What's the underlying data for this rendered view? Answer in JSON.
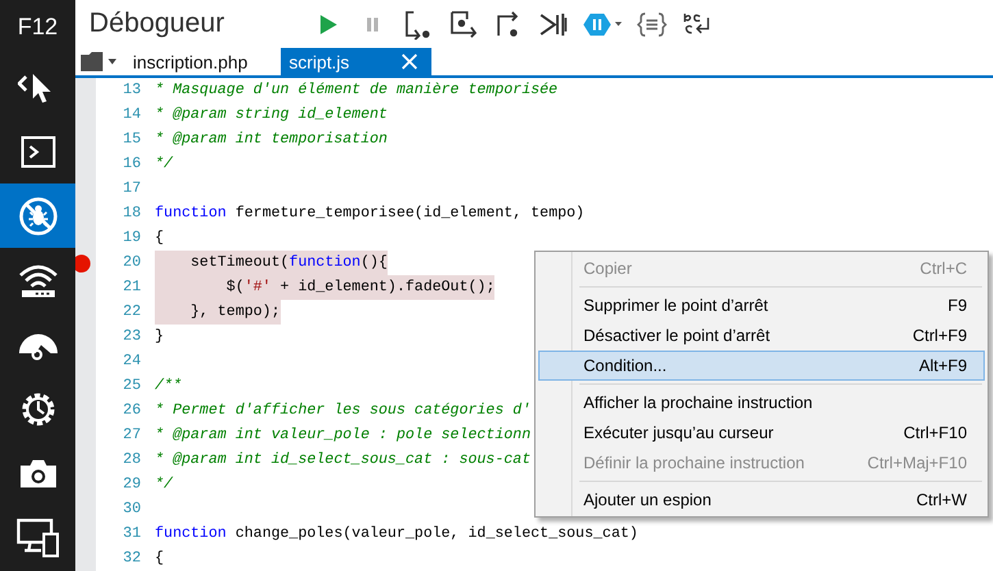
{
  "sidebar": {
    "title": "F12",
    "items": [
      {
        "kind": "pointer",
        "selected": false
      },
      {
        "kind": "console",
        "selected": false
      },
      {
        "kind": "debugger",
        "selected": true
      },
      {
        "kind": "network",
        "selected": false
      },
      {
        "kind": "gauge",
        "selected": false
      },
      {
        "kind": "clock",
        "selected": false
      },
      {
        "kind": "camera",
        "selected": false
      },
      {
        "kind": "devices",
        "selected": false
      }
    ]
  },
  "toolbar": {
    "title": "Débogueur",
    "buttons": [
      {
        "kind": "continue",
        "disabled": false
      },
      {
        "kind": "pause",
        "disabled": true
      },
      {
        "kind": "step-into",
        "disabled": false
      },
      {
        "kind": "step-over",
        "disabled": false
      },
      {
        "kind": "step-out",
        "disabled": false
      },
      {
        "kind": "break-new-worker",
        "disabled": false
      },
      {
        "kind": "exceptions",
        "disabled": false
      },
      {
        "kind": "pretty-print",
        "disabled": false
      },
      {
        "kind": "word-wrap",
        "disabled": false
      }
    ]
  },
  "tabs": [
    {
      "label": "inscription.php",
      "selected": false
    },
    {
      "label": "script.js",
      "selected": true
    }
  ],
  "editor": {
    "lines": [
      {
        "number": "13",
        "breakpoint": false,
        "highlighted": false,
        "tokens": [
          {
            "kind": "comment",
            "text": "* Masquage d'un élément de manière temporisée"
          }
        ]
      },
      {
        "number": "14",
        "breakpoint": false,
        "highlighted": false,
        "tokens": [
          {
            "kind": "comment",
            "text": "* @param string id_element"
          }
        ]
      },
      {
        "number": "15",
        "breakpoint": false,
        "highlighted": false,
        "tokens": [
          {
            "kind": "comment",
            "text": "* @param int temporisation"
          }
        ]
      },
      {
        "number": "16",
        "breakpoint": false,
        "highlighted": false,
        "tokens": [
          {
            "kind": "comment",
            "text": "*/"
          }
        ]
      },
      {
        "number": "17",
        "breakpoint": false
      },
      {
        "number": "18",
        "breakpoint": false,
        "highlighted": false,
        "tokens": [
          {
            "kind": "keyword",
            "text": "function"
          },
          {
            "kind": "plain",
            "text": " fermeture_temporisee(id_element, tempo)"
          }
        ]
      },
      {
        "number": "19",
        "breakpoint": false,
        "highlighted": false,
        "tokens": [
          {
            "kind": "plain",
            "text": "{"
          }
        ]
      },
      {
        "number": "20",
        "breakpoint": true,
        "highlighted": true,
        "tokens": [
          {
            "kind": "plain",
            "text": "    setTimeout("
          },
          {
            "kind": "keyword",
            "text": "function"
          },
          {
            "kind": "plain",
            "text": "(){"
          }
        ]
      },
      {
        "number": "21",
        "breakpoint": false,
        "highlighted": true,
        "tokens": [
          {
            "kind": "plain",
            "text": "        $("
          },
          {
            "kind": "string",
            "text": "'#'"
          },
          {
            "kind": "plain",
            "text": " + id_element).fadeOut();"
          }
        ]
      },
      {
        "number": "22",
        "breakpoint": false,
        "highlighted": true,
        "tokens": [
          {
            "kind": "plain",
            "text": "    }, tempo);"
          }
        ]
      },
      {
        "number": "23",
        "breakpoint": false,
        "highlighted": false,
        "tokens": [
          {
            "kind": "plain",
            "text": "}"
          }
        ]
      },
      {
        "number": "24",
        "breakpoint": false
      },
      {
        "number": "25",
        "breakpoint": false,
        "highlighted": false,
        "tokens": [
          {
            "kind": "comment",
            "text": "/**"
          }
        ]
      },
      {
        "number": "26",
        "breakpoint": false,
        "highlighted": false,
        "tokens": [
          {
            "kind": "comment",
            "text": "* Permet d'afficher les sous catégories d'"
          }
        ]
      },
      {
        "number": "27",
        "breakpoint": false,
        "highlighted": false,
        "tokens": [
          {
            "kind": "comment",
            "text": "* @param int valeur_pole : pole selectionn"
          }
        ]
      },
      {
        "number": "28",
        "breakpoint": false,
        "highlighted": false,
        "tokens": [
          {
            "kind": "comment",
            "text": "* @param int id_select_sous_cat : sous-cat"
          }
        ]
      },
      {
        "number": "29",
        "breakpoint": false,
        "highlighted": false,
        "tokens": [
          {
            "kind": "comment",
            "text": "*/"
          }
        ]
      },
      {
        "number": "30",
        "breakpoint": false
      },
      {
        "number": "31",
        "breakpoint": false,
        "highlighted": false,
        "tokens": [
          {
            "kind": "keyword",
            "text": "function"
          },
          {
            "kind": "plain",
            "text": " change_poles(valeur_pole, id_select_sous_cat)"
          }
        ]
      },
      {
        "number": "32",
        "breakpoint": false,
        "highlighted": false,
        "tokens": [
          {
            "kind": "plain",
            "text": "{"
          }
        ]
      }
    ]
  },
  "context_menu": {
    "items": [
      {
        "kind": "item",
        "label": "Copier",
        "shortcut": "Ctrl+C",
        "disabled": true,
        "selected": false
      },
      {
        "kind": "separator"
      },
      {
        "kind": "item",
        "label": "Supprimer le point d’arrêt",
        "shortcut": "F9",
        "disabled": false,
        "selected": false
      },
      {
        "kind": "item",
        "label": "Désactiver le point d’arrêt",
        "shortcut": "Ctrl+F9",
        "disabled": false,
        "selected": false
      },
      {
        "kind": "item",
        "label": "Condition...",
        "shortcut": "Alt+F9",
        "disabled": false,
        "selected": true
      },
      {
        "kind": "separator"
      },
      {
        "kind": "item",
        "label": "Afficher la prochaine instruction",
        "disabled": false,
        "selected": false
      },
      {
        "kind": "item",
        "label": "Exécuter jusqu’au curseur",
        "shortcut": "Ctrl+F10",
        "disabled": false,
        "selected": false
      },
      {
        "kind": "item",
        "label": "Définir la prochaine instruction",
        "shortcut": "Ctrl+Maj+F10",
        "disabled": true,
        "selected": false
      },
      {
        "kind": "separator"
      },
      {
        "kind": "item",
        "label": "Ajouter un espion",
        "shortcut": "Ctrl+W",
        "disabled": false,
        "selected": false
      }
    ]
  }
}
